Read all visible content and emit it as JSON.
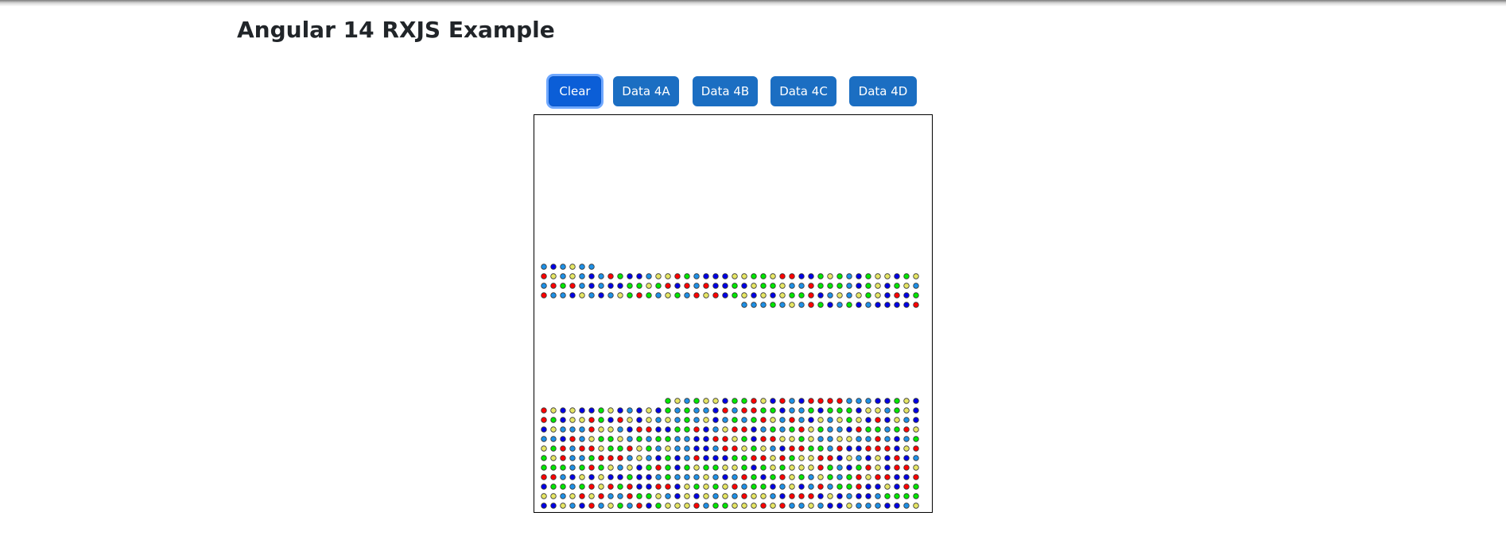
{
  "page": {
    "title": "Angular 14 RXJS Example"
  },
  "toolbar": {
    "buttons": [
      {
        "label": "Clear",
        "focused": true
      },
      {
        "label": "Data 4A",
        "focused": false
      },
      {
        "label": "Data 4B",
        "focused": false
      },
      {
        "label": "Data 4C",
        "focused": false
      },
      {
        "label": "Data 4D",
        "focused": false
      }
    ]
  },
  "board": {
    "colors": {
      "red": "#ff0000",
      "blue": "#0000e6",
      "green": "#00e600",
      "skyblue": "#1e90e6",
      "yellow": "#e6e664"
    },
    "cluster_top": {
      "row_counts": [
        6,
        40,
        40,
        40,
        19
      ],
      "last_row_start_column": 21
    },
    "cluster_bottom": {
      "row_counts": [
        27,
        40,
        40,
        40,
        40,
        40,
        40,
        40,
        40,
        40,
        40,
        40
      ]
    }
  }
}
